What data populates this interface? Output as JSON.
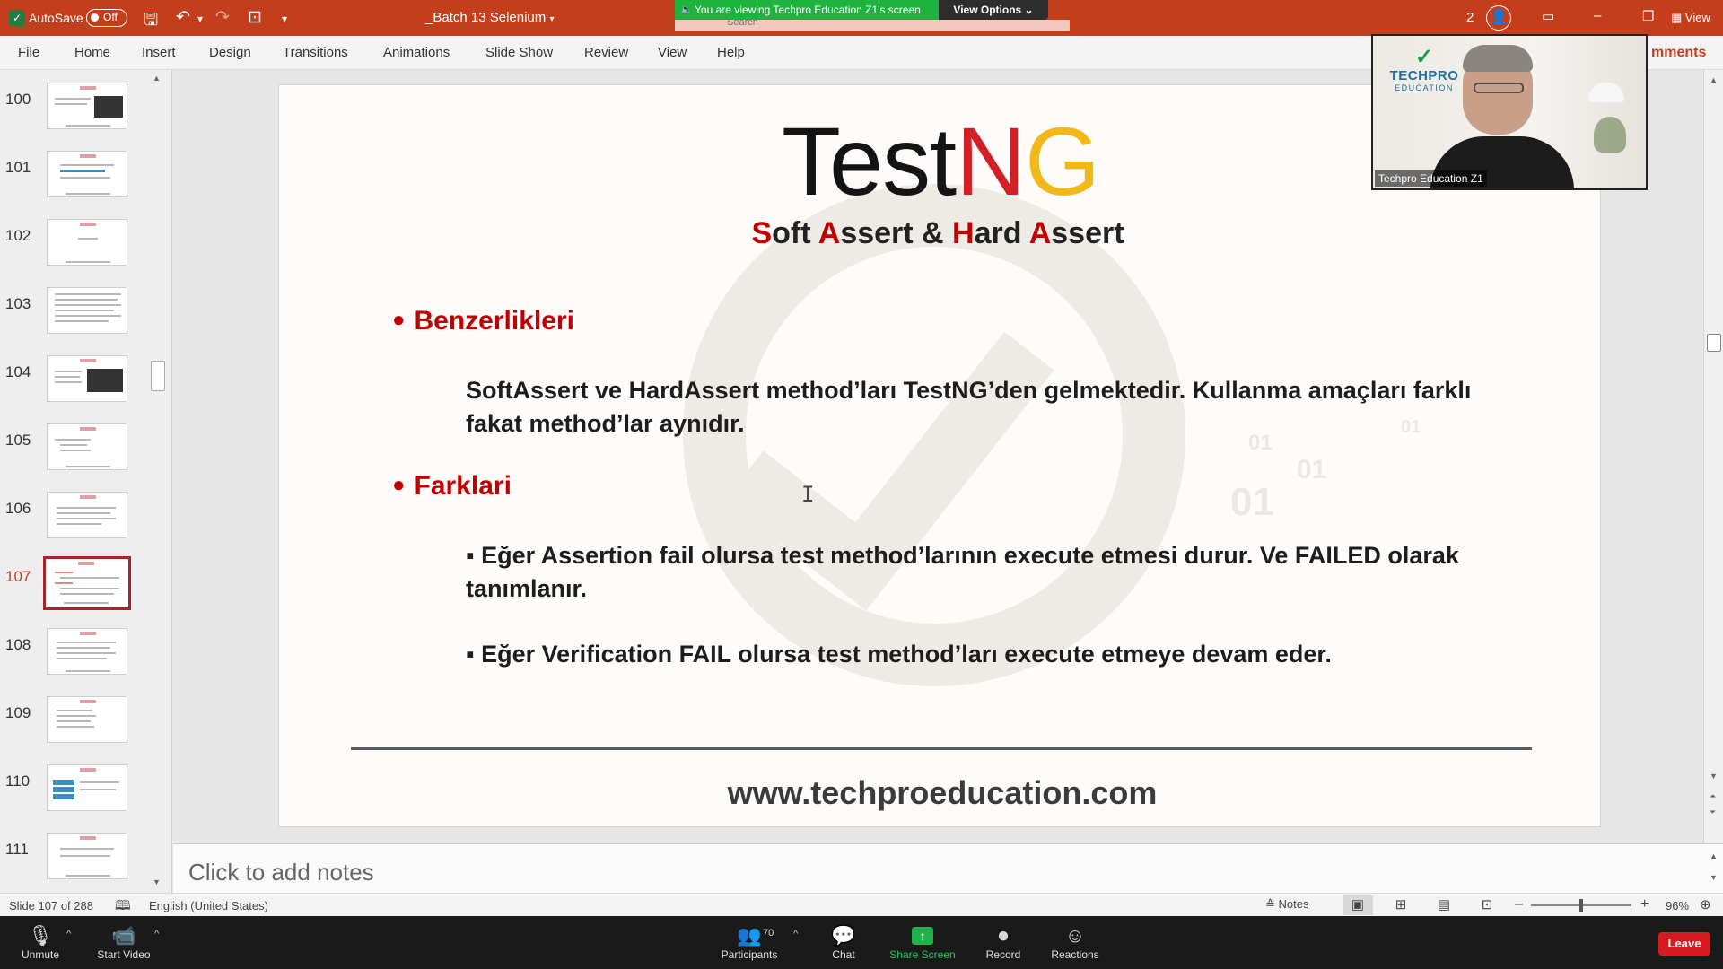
{
  "titlebar": {
    "autosave_label": "AutoSave",
    "autosave_state": "Off",
    "doc_title": "_Batch 13 Selenium",
    "participant_count": "2",
    "view_label": "View"
  },
  "zoom_banner": {
    "viewing_text": "You are viewing Techpro Education Z1's screen",
    "view_options": "View Options",
    "search_placeholder": "Search"
  },
  "ribbon": {
    "tabs": [
      "File",
      "Home",
      "Insert",
      "Design",
      "Transitions",
      "Animations",
      "Slide Show",
      "Review",
      "View",
      "Help"
    ],
    "comments_label": "mments"
  },
  "thumbnails": [
    {
      "num": "100"
    },
    {
      "num": "101"
    },
    {
      "num": "102"
    },
    {
      "num": "103"
    },
    {
      "num": "104"
    },
    {
      "num": "105"
    },
    {
      "num": "106"
    },
    {
      "num": "107",
      "active": true
    },
    {
      "num": "108"
    },
    {
      "num": "109"
    },
    {
      "num": "110"
    },
    {
      "num": "111"
    }
  ],
  "slide": {
    "logo_parts": [
      "Test",
      "N",
      "G"
    ],
    "subtitle_parts": [
      "S",
      "oft ",
      "A",
      "ssert & ",
      "H",
      "ard ",
      "A",
      "ssert"
    ],
    "section1_title": "Benzerlikleri",
    "section1_body": "SoftAssert ve HardAssert method’ları TestNG’den gelmektedir. Kullanma amaçları farklı fakat method’lar aynıdır.",
    "section2_title": "Farklari",
    "section2_item1": "▪ Eğer Assertion fail olursa test method’larının execute etmesi durur. Ve FAILED olarak tanımlanır.",
    "section2_item2": "▪ Eğer Verification FAIL olursa test method’ları execute etmeye devam eder.",
    "website": "www.techproeducation.com",
    "watermark_digits": [
      "01",
      "01",
      "01",
      "01"
    ]
  },
  "notes": {
    "placeholder": "Click to add notes"
  },
  "statusbar": {
    "slide_info": "Slide 107 of 288",
    "language": "English (United States)",
    "notes_label": "Notes",
    "zoom_level": "96%"
  },
  "zoom_toolbar": {
    "unmute": "Unmute",
    "start_video": "Start Video",
    "participants": "Participants",
    "participants_count": "70",
    "chat": "Chat",
    "share_screen": "Share Screen",
    "record": "Record",
    "reactions": "Reactions",
    "leave": "Leave"
  },
  "video_tile": {
    "name": "Techpro Education Z1",
    "brand_name": "TECHPRO",
    "brand_sub": "EDUCATION"
  },
  "colors": {
    "powerpoint_red": "#c43e1c",
    "zoom_green": "#1eb33f",
    "slide_accent_red": "#c00000",
    "testng_yellow": "#f2b818"
  }
}
